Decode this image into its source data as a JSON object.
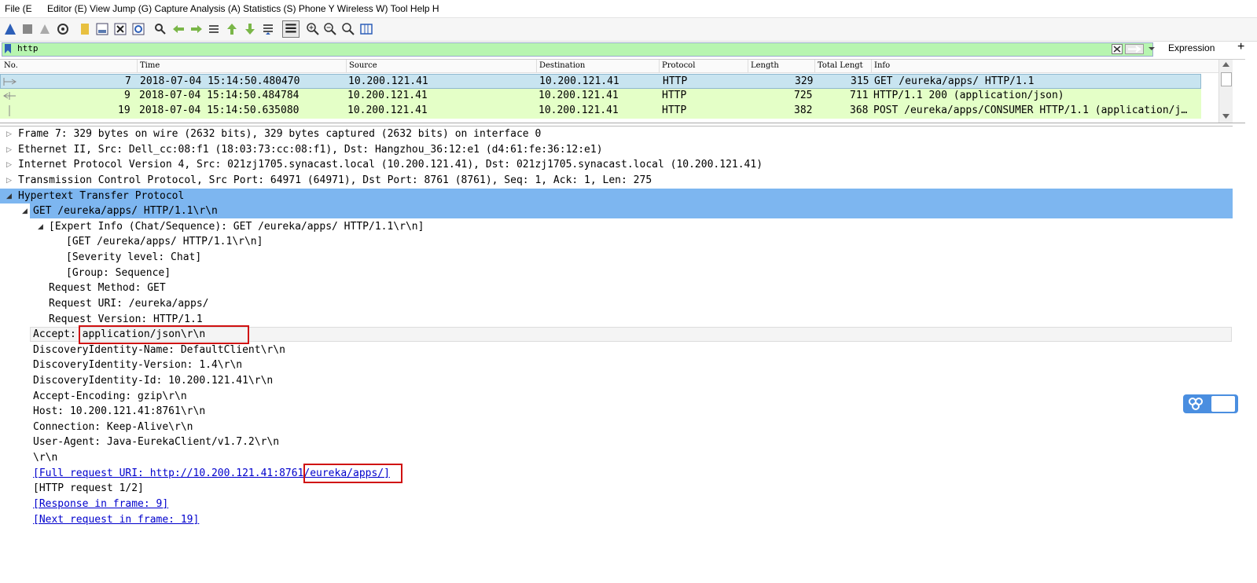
{
  "menu": {
    "items": [
      "File (E",
      "Editor (E)",
      "View Jump (G) Capture Analysis (A) Statistics (S) Phone Y Wireless W) Tool Help H"
    ]
  },
  "toolbar": {
    "icons": [
      "shark-fin-start-icon",
      "stop-icon",
      "restart-icon",
      "options-gear-icon",
      "open-folder-icon",
      "save-icon",
      "close-file-icon",
      "reload-icon",
      "find-icon",
      "back-icon",
      "forward-icon",
      "go-to-packet-icon",
      "first-packet-icon",
      "last-packet-icon",
      "autoscroll-icon",
      "colorize-icon",
      "zoom-in-icon",
      "zoom-out-icon",
      "normal-size-icon",
      "resize-columns-icon"
    ]
  },
  "filter": {
    "value": "http",
    "expression_label": "Expression",
    "plus_label": "+"
  },
  "packet_list": {
    "columns": [
      "No.",
      "Time",
      "Source",
      "Destination",
      "Protocol",
      "Length",
      "Total Lengt",
      "Info"
    ],
    "rows": [
      {
        "no": "7",
        "time": "2018-07-04 15:14:50.480470",
        "source": "10.200.121.41",
        "destination": "10.200.121.41",
        "protocol": "HTTP",
        "length": "329",
        "total": "315",
        "info": "GET /eureka/apps/ HTTP/1.1"
      },
      {
        "no": "9",
        "time": "2018-07-04 15:14:50.484784",
        "source": "10.200.121.41",
        "destination": "10.200.121.41",
        "protocol": "HTTP",
        "length": "725",
        "total": "711",
        "info": "HTTP/1.1 200   (application/json)"
      },
      {
        "no": "19",
        "time": "2018-07-04 15:14:50.635080",
        "source": "10.200.121.41",
        "destination": "10.200.121.41",
        "protocol": "HTTP",
        "length": "382",
        "total": "368",
        "info": "POST /eureka/apps/CONSUMER HTTP/1.1  (application/j…"
      }
    ]
  },
  "details": {
    "frame": "Frame 7: 329 bytes on wire (2632 bits), 329 bytes captured (2632 bits) on interface 0",
    "ethernet": "Ethernet II, Src: Dell_cc:08:f1 (18:03:73:cc:08:f1), Dst: Hangzhou_36:12:e1 (d4:61:fe:36:12:e1)",
    "ip": "Internet Protocol Version 4, Src: 021zj1705.synacast.local (10.200.121.41), Dst: 021zj1705.synacast.local (10.200.121.41)",
    "tcp": "Transmission Control Protocol, Src Port: 64971 (64971), Dst Port: 8761 (8761), Seq: 1, Ack: 1, Len: 275",
    "http": "Hypertext Transfer Protocol",
    "get_line": "GET /eureka/apps/ HTTP/1.1\\r\\n",
    "expert": "[Expert Info (Chat/Sequence): GET /eureka/apps/ HTTP/1.1\\r\\n]",
    "expert_get": "[GET /eureka/apps/ HTTP/1.1\\r\\n]",
    "severity": "[Severity level: Chat]",
    "group": "[Group: Sequence]",
    "req_method": "Request Method: GET",
    "req_uri": "Request URI: /eureka/apps/",
    "req_version": "Request Version: HTTP/1.1",
    "accept_label": "Accept: ",
    "accept_value": "application/json\\r\\n",
    "disc_name": "DiscoveryIdentity-Name: DefaultClient\\r\\n",
    "disc_version": "DiscoveryIdentity-Version: 1.4\\r\\n",
    "disc_id": "DiscoveryIdentity-Id: 10.200.121.41\\r\\n",
    "accept_encoding": "Accept-Encoding: gzip\\r\\n",
    "host": "Host: 10.200.121.41:8761\\r\\n",
    "connection": "Connection: Keep-Alive\\r\\n",
    "user_agent": "User-Agent: Java-EurekaClient/v1.7.2\\r\\n",
    "crlf": "\\r\\n",
    "full_uri_a": "[Full request URI: http://10.200.121.41:8761",
    "full_uri_b": "/eureka/apps/]",
    "http_request": "[HTTP request 1/2]",
    "response_frame": "[Response in frame: 9]",
    "next_request": "[Next request in frame: 19]"
  },
  "colors": {
    "filter_bg": "#b7f5b0",
    "selected_row": "#c8e4f0",
    "http_row": "#e4ffc7",
    "tree_selected": "#7db6f0",
    "highlight_box": "#d01010"
  }
}
